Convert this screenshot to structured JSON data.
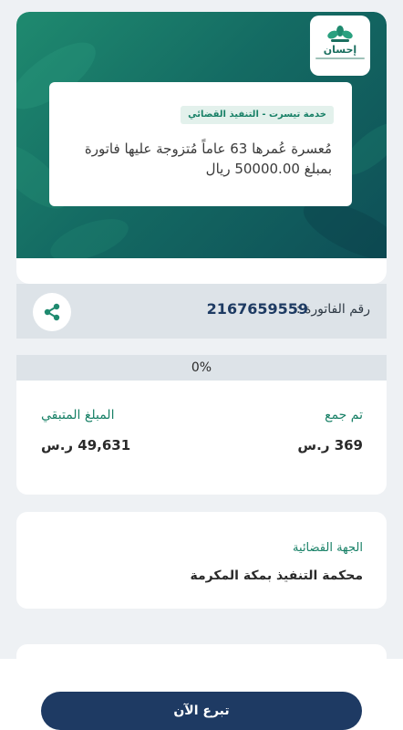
{
  "brand": {
    "name": "إحسان",
    "logo": "ehsan-logo"
  },
  "campaign": {
    "service_tag": "خدمة تيسرت - التنفيذ القضائي",
    "description": "مُعسرة عُمرها 63 عاماً مُتزوجة عليها فاتورة بمبلغ 50000.00 ريال"
  },
  "invoice": {
    "label": "رقم الفاتورة :",
    "number": "2167659559",
    "share_icon": "share-icon"
  },
  "progress": {
    "text": "0%",
    "value": 0
  },
  "stats": {
    "collected_label": "تم جمع",
    "collected_value": "369 ر.س",
    "remaining_label": "المبلغ المتبقي",
    "remaining_value": "49,631 ر.س"
  },
  "authority": {
    "label": "الجهة القضائية",
    "value": "محكمة التنفيذ بمكة المكرمة"
  },
  "actions": {
    "donate_label": "تبرع الآن"
  },
  "colors": {
    "accent_green": "#178066",
    "navy": "#1e3a63",
    "hero_dark": "#0e4f57"
  }
}
